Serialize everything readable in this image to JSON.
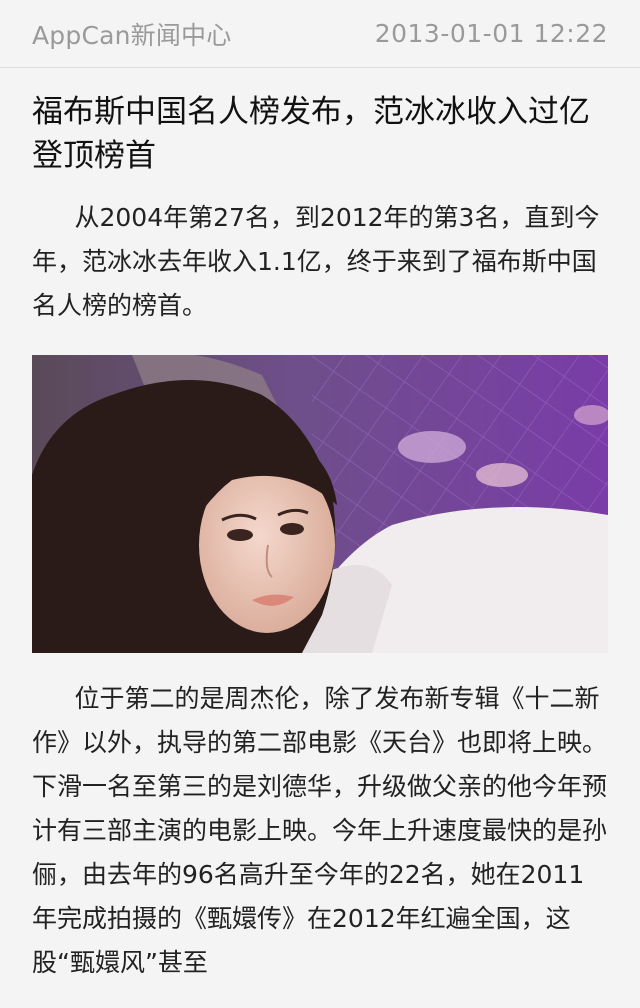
{
  "header": {
    "app_name": "AppCan新闻中心",
    "datetime": "2013-01-01   12:22"
  },
  "article": {
    "title": "福布斯中国名人榜发布，范冰冰收入过亿登顶榜首",
    "intro": "从2004年第27名，到2012年的第3名，直到今年，范冰冰去年收入1.1亿，终于来到了福布斯中国名人榜的榜首。",
    "image": "photo of a woman with long dark hair lying on a purple floral bedspread",
    "body": "位于第二的是周杰伦，除了发布新专辑《十二新作》以外，执导的第二部电影《天台》也即将上映。下滑一名至第三的是刘德华，升级做父亲的他今年预计有三部主演的电影上映。今年上升速度最快的是孙俪，由去年的96名高升至今年的22名，她在2011年完成拍摄的《甄嬛传》在2012年红遍全国，这股“甄嬛风”甚至"
  },
  "colors": {
    "background": "#f4f4f4",
    "header_text": "#9a9a9a",
    "body_text": "#222222",
    "bedspread": "#7a3ca8"
  }
}
